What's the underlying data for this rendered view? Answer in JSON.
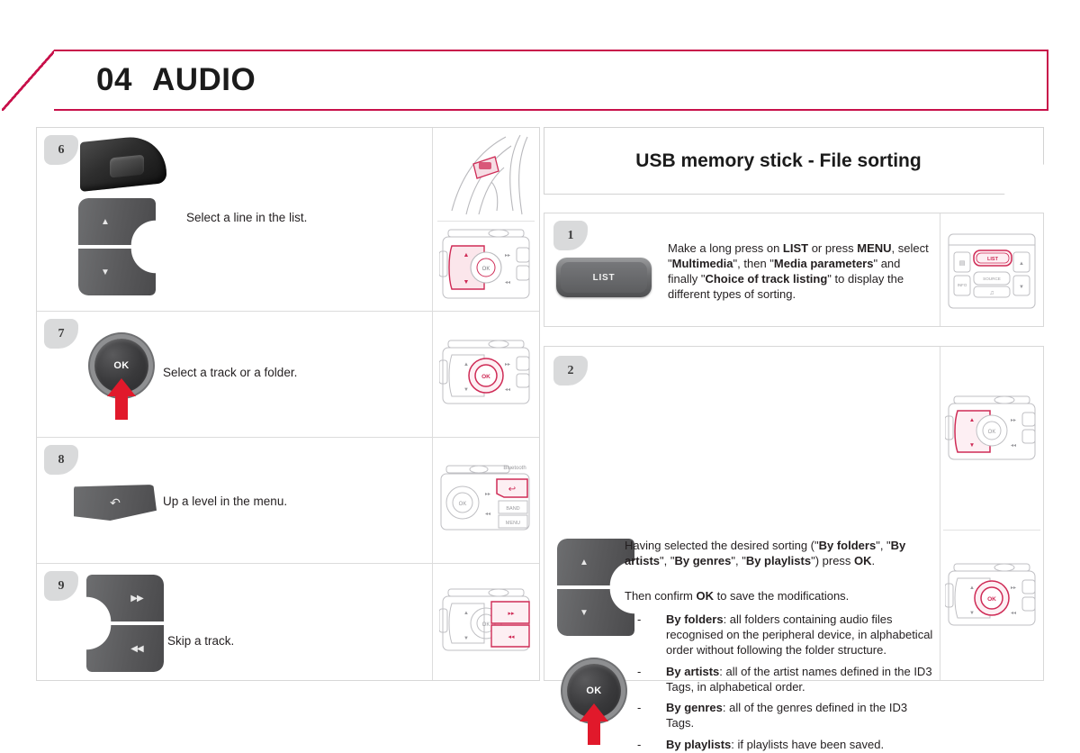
{
  "header": {
    "number": "04",
    "title": "AUDIO",
    "accent_color": "#c8104a"
  },
  "left_column": {
    "steps": [
      {
        "number": "6",
        "text": "Select a line in the list.",
        "controls": [
          "steering-wheel-pad",
          "up-down-rocker"
        ],
        "glyph_up": "▲",
        "glyph_down": "▼",
        "thumbnails": [
          "steering-wheel-diagram",
          "control-panel-updown-diagram"
        ]
      },
      {
        "number": "7",
        "text": "Select a track or a folder.",
        "controls": [
          "ok-knob"
        ],
        "ok_label": "OK",
        "thumbnails": [
          "control-panel-ok-diagram"
        ]
      },
      {
        "number": "8",
        "text": "Up a level in the menu.",
        "controls": [
          "back-key"
        ],
        "back_glyph": "↶",
        "thumbnails": [
          "control-panel-back-diagram"
        ]
      },
      {
        "number": "9",
        "text": "Skip a track.",
        "controls": [
          "skip-rocker"
        ],
        "glyph_next": "▶▶",
        "glyph_prev": "◀◀",
        "thumbnails": [
          "control-panel-skip-diagram"
        ]
      }
    ]
  },
  "right_column": {
    "section_title": "USB memory stick - File sorting",
    "steps": [
      {
        "number": "1",
        "button_label": "LIST",
        "paragraph_html": "Make a long press on <b>LIST</b> or press <b>MENU</b>, select \"<b>Multimedia</b>\", then \"<b>Media parameters</b>\" and finally \"<b>Choice of track listing</b>\" to display the different types of sorting.",
        "thumbnails": [
          "facia-list-button-diagram"
        ]
      },
      {
        "number": "2",
        "paragraph1_html": "Having selected the desired sorting (\"<b>By folders</b>\", \"<b>By artists</b>\", \"<b>By genres</b>\", \"<b>By playlists</b>\") press <b>OK</b>.",
        "paragraph2_html": "Then confirm <b>OK</b> to save the modifications.",
        "ok_label": "OK",
        "glyph_up": "▲",
        "glyph_down": "▼",
        "bullet_marker": "-",
        "bullets_html": [
          "<b>By folders</b>: all folders containing audio files recognised on the peripheral device, in alphabetical order without following the folder structure.",
          "<b>By artists</b>: all of the artist names defined in the ID3 Tags, in alphabetical order.",
          "<b>By genres</b>: all of the genres defined in the ID3 Tags.",
          "<b>By playlists</b>: if playlists have been saved."
        ],
        "thumbnails": [
          "control-panel-updown-diagram",
          "control-panel-ok-diagram"
        ]
      }
    ]
  },
  "diagram_labels": {
    "ok": "OK",
    "list": "LIST",
    "band": "BAND",
    "menu": "MENU",
    "source": "SOURCE",
    "info": "INFO",
    "bluetooth": "Bluetooth",
    "next": "▸▸",
    "prev": "◂◂"
  }
}
